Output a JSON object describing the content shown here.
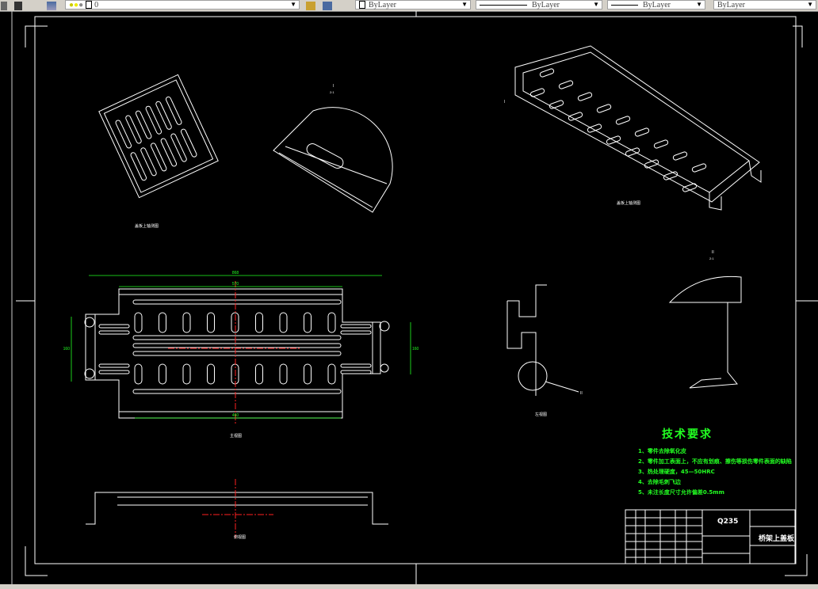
{
  "toolbar": {
    "layer_value": "0",
    "color_value": "ByLayer",
    "linetype_value": "ByLayer",
    "lineweight_value": "ByLayer",
    "plotstyle_value": "ByLayer",
    "icons": [
      "layer-manager-icon",
      "bulb-icon",
      "sun-icon",
      "lock-icon",
      "color-swatch-icon"
    ]
  },
  "drawing": {
    "detail_I_label": "I",
    "detail_I_scale": "2:1",
    "detail_II_label": "II",
    "detail_II_scale": "2:1",
    "leader_I": "I",
    "leader_II": "II",
    "view_labels": {
      "iso_small": "盖板上轴测图",
      "iso_large": "盖板上轴测图",
      "plan": "主视图",
      "side": "左视图",
      "front": "俯视图"
    },
    "dims": {
      "overall_length": "868",
      "inner_length": "570",
      "slot_span": "460",
      "height_left": "160",
      "height_right": "160"
    }
  },
  "tech_requirements": {
    "title": "技术要求",
    "items": [
      "1、零件去除氧化皮",
      "2、零件加工表面上，不应有划痕、擦伤等损伤零件表面的缺陷",
      "3、热处理硬度，45—50HRC",
      "4、去除毛刺飞边",
      "5、未注长度尺寸允许偏差0.5mm"
    ]
  },
  "title_block": {
    "material": "Q235",
    "part_name": "桥架上盖板"
  },
  "colors": {
    "background": "#000000",
    "lines": "#ffffff",
    "dimension": "#22ff22",
    "center": "#ff2020",
    "toolbar": "#d4d0c8"
  }
}
